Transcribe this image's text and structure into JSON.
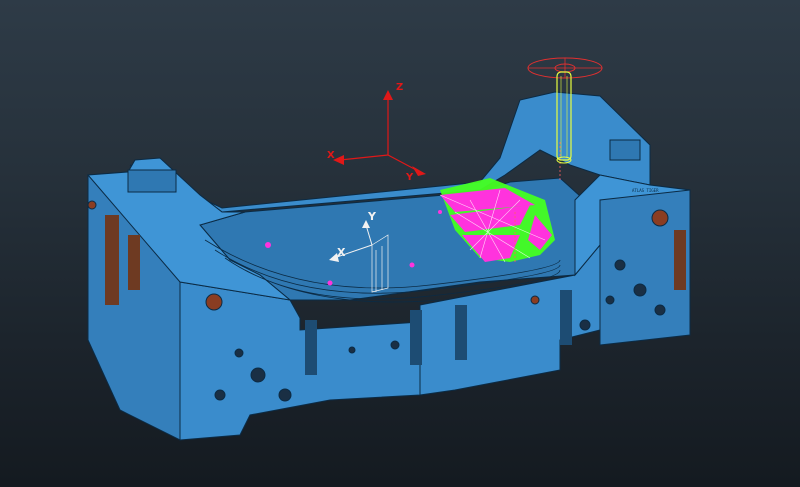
{
  "viewport": {
    "background_top": "#2e3b47",
    "background_bottom": "#141a20"
  },
  "model": {
    "body_color": "#3a8ccc",
    "edge_color": "#0b2b45",
    "hole_color": "#8a3d22",
    "engraving_1": "ATLAS TIGER"
  },
  "machine_triad": {
    "color": "#e01818",
    "z_label": "Z",
    "x_label": "X",
    "y_label": "Y"
  },
  "work_triad": {
    "color": "#f2f2f2",
    "x_label": "X",
    "y_label": "Y"
  },
  "toolpath": {
    "colors": [
      "#ff33dd",
      "#44ff22",
      "#ffffff"
    ]
  },
  "tool": {
    "holder_color": "#e03030",
    "cutter_color": "#e8ff40"
  }
}
